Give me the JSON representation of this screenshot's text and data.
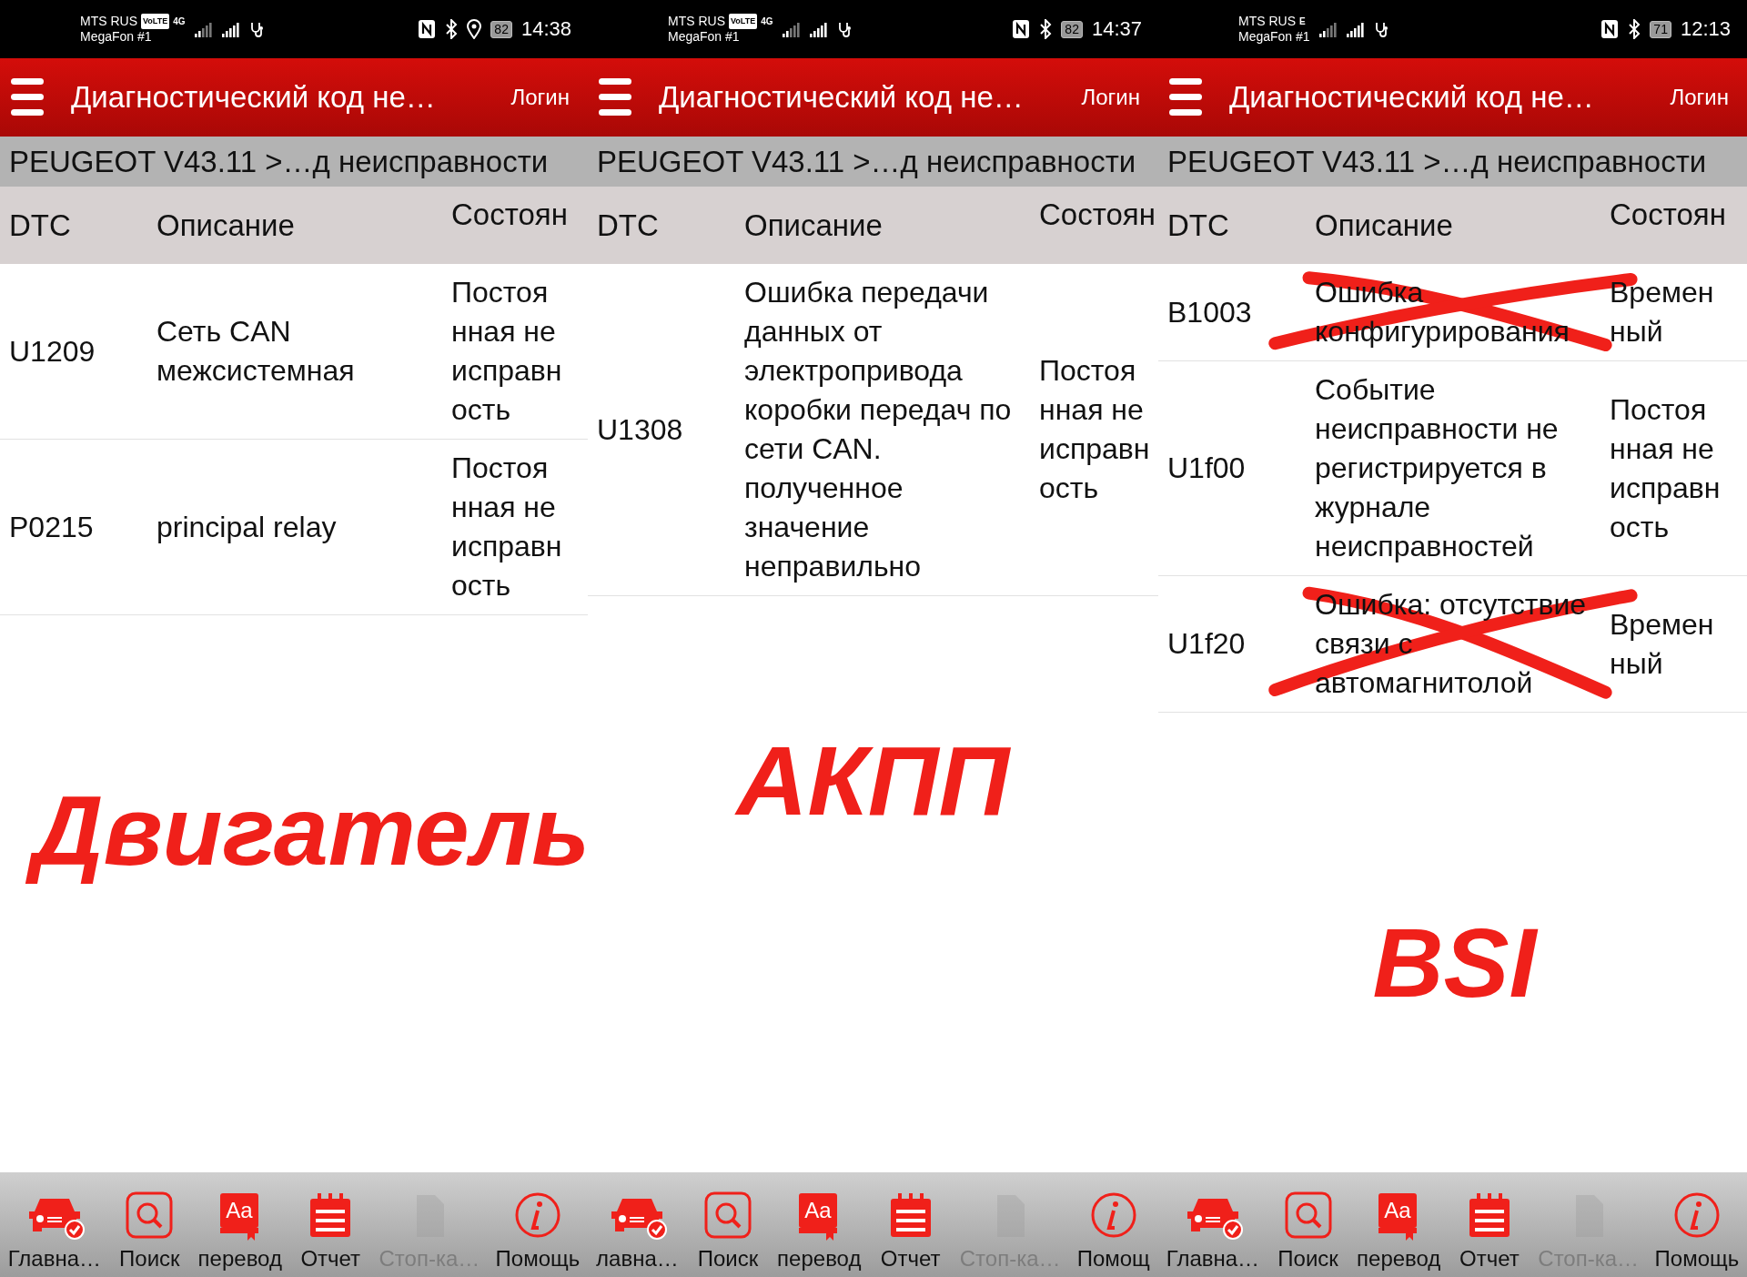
{
  "panels": [
    {
      "status": {
        "carrier": "MTS RUS",
        "volte": "VoLTE",
        "network": "4G",
        "carrier2": "MegaFon #1",
        "location": true,
        "battery": "82",
        "time": "14:38"
      },
      "header": {
        "title": "Диагностический код не…",
        "login": "Логин"
      },
      "breadcrumb": "PEUGEOT V43.11 >…д неисправности",
      "columns": [
        "DTC",
        "Описание",
        "Состоян"
      ],
      "rows": [
        {
          "dtc": "U1209",
          "description": "Сеть CAN межсистемная",
          "state": "Постоянная неисправность",
          "crossed": false
        },
        {
          "dtc": "P0215",
          "description": "principal relay",
          "state": "Постоянная неисправность",
          "crossed": false
        }
      ],
      "annotation": "Двигатель",
      "nav": [
        {
          "kind": "car",
          "label": "Главна…",
          "disabled": false
        },
        {
          "kind": "search",
          "label": "Поиск",
          "disabled": false
        },
        {
          "kind": "dictionary",
          "glyph": "Aa",
          "label": "перевод",
          "disabled": false
        },
        {
          "kind": "report",
          "label": "Отчет",
          "disabled": false
        },
        {
          "kind": "document",
          "label": "Стоп-ка…",
          "disabled": true
        },
        {
          "kind": "info",
          "label": "Помощь",
          "disabled": false
        }
      ]
    },
    {
      "status": {
        "carrier": "MTS RUS",
        "volte": "VoLTE",
        "network": "4G",
        "carrier2": "MegaFon #1",
        "location": false,
        "battery": "82",
        "time": "14:37"
      },
      "header": {
        "title": "Диагностический код не…",
        "login": "Логин"
      },
      "breadcrumb": "PEUGEOT V43.11 >…д неисправности",
      "columns": [
        "DTC",
        "Описание",
        "Состоян"
      ],
      "rows": [
        {
          "dtc": "U1308",
          "description": "Ошибка передачи данных от электропривода коробки передач по сети CAN. полученное значение неправильно",
          "state": "Постоянная неисправность",
          "crossed": false
        }
      ],
      "annotation": "АКПП",
      "nav": [
        {
          "kind": "car",
          "label": "лавна…",
          "disabled": false
        },
        {
          "kind": "search",
          "label": "Поиск",
          "disabled": false
        },
        {
          "kind": "dictionary",
          "glyph": "Aa",
          "label": "перевод",
          "disabled": false
        },
        {
          "kind": "report",
          "label": "Отчет",
          "disabled": false
        },
        {
          "kind": "document",
          "label": "Стоп-ка…",
          "disabled": true
        },
        {
          "kind": "info",
          "label": "Помощ",
          "disabled": false
        }
      ]
    },
    {
      "status": {
        "carrier": "MTS RUS",
        "network": "E",
        "carrier2": "MegaFon #1",
        "location": false,
        "battery": "71",
        "time": "12:13"
      },
      "header": {
        "title": "Диагностический код не…",
        "login": "Логин"
      },
      "breadcrumb": "PEUGEOT V43.11 >…д неисправности",
      "columns": [
        "DTC",
        "Описание",
        "Состоян"
      ],
      "rows": [
        {
          "dtc": "B1003",
          "description": "Ошибка конфигурирования",
          "state": "Временный",
          "crossed": true
        },
        {
          "dtc": "U1f00",
          "description": "Событие неисправности не регистрируется в журнале неисправностей",
          "state": "Постоянная неисправность",
          "crossed": false
        },
        {
          "dtc": "U1f20",
          "description": "Ошибка: отсутствие связи с автомагнитолой",
          "state": "Временный",
          "crossed": true
        }
      ],
      "annotation": "BSI",
      "nav": [
        {
          "kind": "car",
          "label": "Главна…",
          "disabled": false
        },
        {
          "kind": "search",
          "label": "Поиск",
          "disabled": false
        },
        {
          "kind": "dictionary",
          "glyph": "Aa",
          "label": "перевод",
          "disabled": false
        },
        {
          "kind": "report",
          "label": "Отчет",
          "disabled": false
        },
        {
          "kind": "document",
          "label": "Стоп-ка…",
          "disabled": true
        },
        {
          "kind": "info",
          "label": "Помощь",
          "disabled": false
        }
      ]
    }
  ]
}
